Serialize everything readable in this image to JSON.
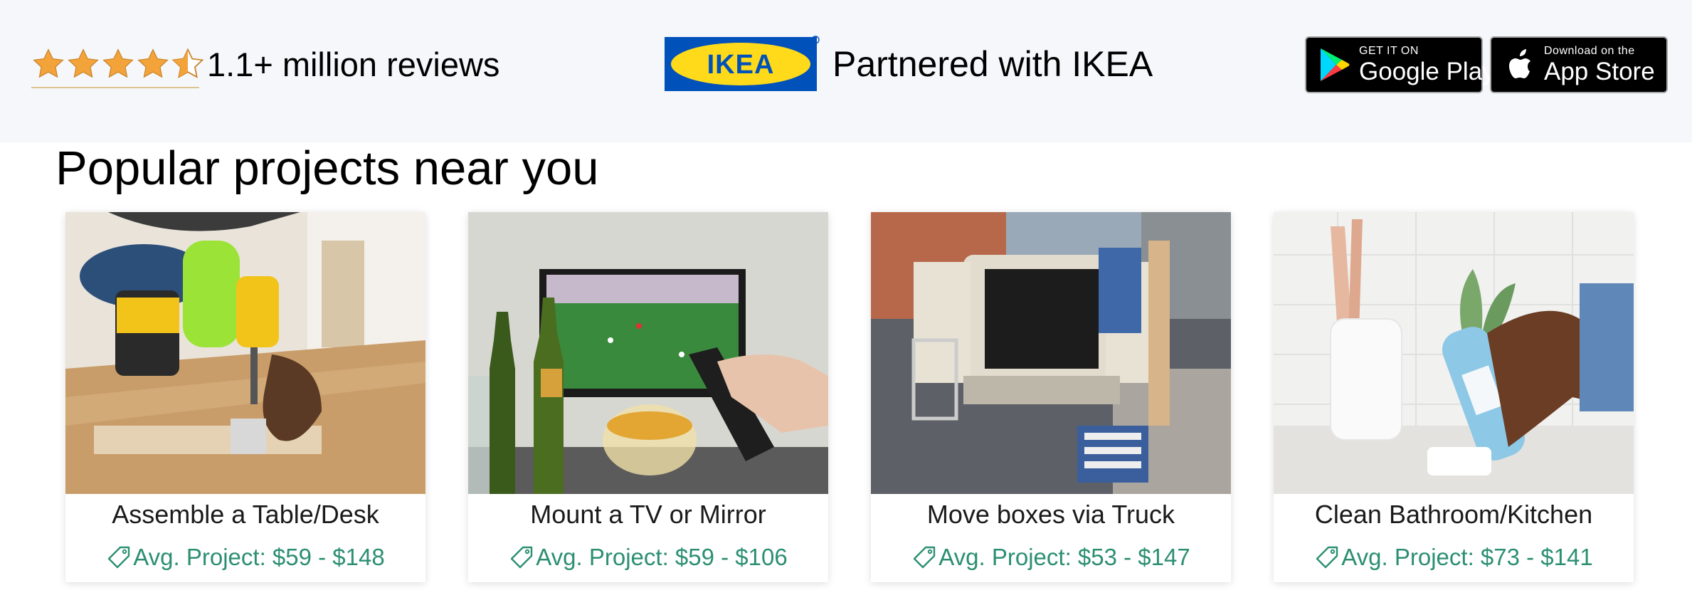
{
  "header": {
    "rating_stars": 4.5,
    "rating_text": "1.1+ million reviews",
    "partner_logo": "IKEA",
    "partner_text": "Partnered with IKEA",
    "google_play": {
      "small": "GET IT ON",
      "big": "Google Play"
    },
    "app_store": {
      "small": "Download on the",
      "big": "App Store"
    }
  },
  "section_title": "Popular projects near you",
  "price_prefix": "Avg. Project:",
  "cards": [
    {
      "title": "Assemble a Table/Desk",
      "price": "Avg. Project: $59 - $148"
    },
    {
      "title": "Mount a TV or Mirror",
      "price": "Avg. Project: $59 - $106"
    },
    {
      "title": "Move boxes via Truck",
      "price": "Avg. Project: $53 - $147"
    },
    {
      "title": "Clean Bathroom/Kitchen",
      "price": "Avg. Project: $73 - $141"
    }
  ],
  "colors": {
    "star": "#f2a33a",
    "ikea_blue": "#0051ba",
    "ikea_yellow": "#ffda1a",
    "price_green": "#2c8f72",
    "topbar_bg": "#f5f7fa"
  }
}
